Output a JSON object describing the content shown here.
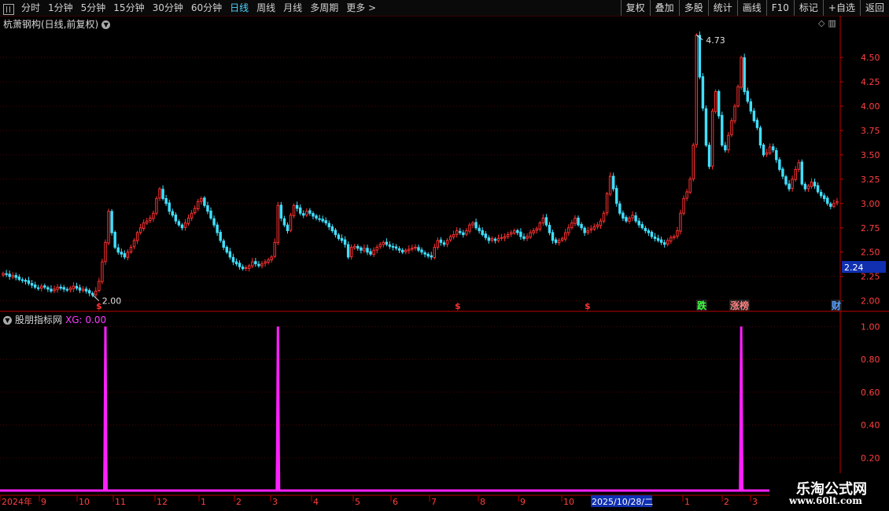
{
  "toolbar": {
    "periods": [
      "分时",
      "1分钟",
      "5分钟",
      "15分钟",
      "30分钟",
      "60分钟",
      "日线",
      "周线",
      "月线",
      "多周期",
      "更多 >"
    ],
    "active_period": "日线",
    "actions": [
      "复权",
      "叠加",
      "多股",
      "统计",
      "画线",
      "F10",
      "标记",
      "+自选",
      "返回"
    ]
  },
  "main_chart": {
    "title": "杭萧钢构(日线,前复权)",
    "high_label": "4.73",
    "low_label": "2.00",
    "current_price": "2.24",
    "y_ticks": [
      "4.50",
      "4.25",
      "4.00",
      "3.75",
      "3.50",
      "3.25",
      "3.00",
      "2.75",
      "2.50",
      "2.25",
      "2.00"
    ],
    "event_markers": [
      {
        "text": "$",
        "color": "#ff3030"
      },
      {
        "text": "$",
        "color": "#ff3030"
      },
      {
        "text": "$",
        "color": "#ff3030"
      },
      {
        "text": "跌",
        "color": "#40ff40"
      },
      {
        "text": "涨榜",
        "color": "#ff8080"
      },
      {
        "text": "财",
        "color": "#5aa0ff"
      }
    ],
    "colors": {
      "up": "#ff3030",
      "down": "#40e0ff",
      "axis": "#c00000",
      "grid": "#5a0000"
    }
  },
  "indicator": {
    "title": "股朋指标网",
    "xg_label": "XG: 0.00",
    "y_ticks": [
      "1.00",
      "0.80",
      "0.60",
      "0.40",
      "0.20"
    ],
    "line_color": "#ff20ff"
  },
  "x_axis": {
    "labels": [
      "2024年",
      "9",
      "10",
      "11",
      "12",
      "1",
      "2",
      "3",
      "4",
      "5",
      "6",
      "7",
      "8",
      "9",
      "10",
      "2025/10/28/二",
      "1",
      "2",
      "3"
    ]
  },
  "watermark": {
    "line1": "乐淘公式网",
    "line2": "www.60lt.com"
  },
  "chart_data": [
    {
      "type": "candlestick",
      "title": "杭萧钢构(日线,前复权)",
      "ylim": [
        1.9,
        4.8
      ],
      "y_ticks": [
        2.0,
        2.25,
        2.5,
        2.75,
        3.0,
        3.25,
        3.5,
        3.75,
        4.0,
        4.25,
        4.5
      ],
      "close": [
        2.28,
        2.27,
        2.25,
        2.26,
        2.24,
        2.22,
        2.21,
        2.2,
        2.18,
        2.16,
        2.14,
        2.13,
        2.15,
        2.14,
        2.12,
        2.1,
        2.12,
        2.14,
        2.13,
        2.12,
        2.11,
        2.13,
        2.15,
        2.13,
        2.11,
        2.12,
        2.1,
        2.08,
        2.06,
        2.1,
        2.2,
        2.4,
        2.6,
        2.92,
        2.7,
        2.55,
        2.5,
        2.48,
        2.45,
        2.5,
        2.55,
        2.62,
        2.7,
        2.75,
        2.8,
        2.82,
        2.85,
        2.9,
        3.05,
        3.15,
        3.05,
        3.0,
        2.92,
        2.88,
        2.82,
        2.78,
        2.75,
        2.8,
        2.85,
        2.9,
        2.95,
        3.02,
        3.05,
        2.98,
        2.92,
        2.85,
        2.78,
        2.7,
        2.62,
        2.55,
        2.5,
        2.45,
        2.4,
        2.38,
        2.35,
        2.33,
        2.34,
        2.36,
        2.4,
        2.38,
        2.36,
        2.38,
        2.4,
        2.42,
        2.45,
        2.6,
        2.98,
        2.85,
        2.78,
        2.72,
        2.88,
        2.98,
        2.95,
        2.9,
        2.88,
        2.92,
        2.9,
        2.87,
        2.85,
        2.84,
        2.82,
        2.8,
        2.76,
        2.72,
        2.68,
        2.64,
        2.62,
        2.58,
        2.45,
        2.55,
        2.56,
        2.54,
        2.52,
        2.54,
        2.5,
        2.48,
        2.52,
        2.55,
        2.58,
        2.6,
        2.58,
        2.56,
        2.55,
        2.54,
        2.52,
        2.5,
        2.52,
        2.53,
        2.54,
        2.55,
        2.52,
        2.5,
        2.48,
        2.46,
        2.45,
        2.55,
        2.62,
        2.6,
        2.58,
        2.62,
        2.66,
        2.68,
        2.72,
        2.7,
        2.68,
        2.72,
        2.78,
        2.8,
        2.75,
        2.72,
        2.68,
        2.65,
        2.62,
        2.64,
        2.62,
        2.64,
        2.65,
        2.66,
        2.68,
        2.7,
        2.72,
        2.7,
        2.66,
        2.64,
        2.66,
        2.7,
        2.72,
        2.74,
        2.8,
        2.85,
        2.78,
        2.7,
        2.62,
        2.6,
        2.62,
        2.64,
        2.7,
        2.75,
        2.8,
        2.85,
        2.78,
        2.75,
        2.7,
        2.72,
        2.74,
        2.76,
        2.78,
        2.82,
        2.9,
        3.1,
        3.28,
        3.15,
        3.0,
        2.9,
        2.85,
        2.82,
        2.85,
        2.88,
        2.82,
        2.78,
        2.75,
        2.72,
        2.7,
        2.66,
        2.64,
        2.62,
        2.6,
        2.58,
        2.62,
        2.65,
        2.66,
        2.72,
        2.9,
        3.05,
        3.12,
        3.25,
        3.6,
        4.73,
        4.3,
        3.98,
        3.6,
        3.38,
        3.95,
        4.15,
        3.9,
        3.6,
        3.55,
        3.7,
        3.85,
        4.0,
        4.2,
        4.5,
        4.15,
        4.05,
        3.95,
        3.85,
        3.78,
        3.6,
        3.5,
        3.52,
        3.58,
        3.55,
        3.45,
        3.35,
        3.28,
        3.2,
        3.15,
        3.25,
        3.35,
        3.42,
        3.2,
        3.15,
        3.18,
        3.22,
        3.18,
        3.12,
        3.08,
        3.05,
        3.0,
        2.97,
        3.0,
        3.02
      ]
    },
    {
      "type": "line",
      "name": "XG",
      "ylim": [
        0,
        1.05
      ],
      "y_ticks": [
        0.2,
        0.4,
        0.6,
        0.8,
        1.0
      ],
      "spikes_at_bar": [
        32,
        86,
        231
      ],
      "baseline": 0
    }
  ]
}
